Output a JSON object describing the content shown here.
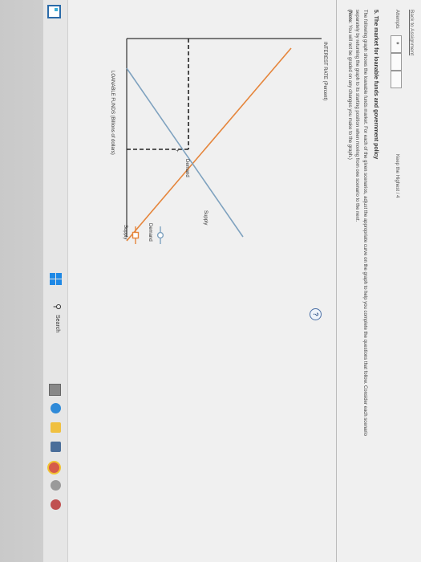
{
  "page": {
    "back_link": "Back to Assignment",
    "attempts_label": "Attempts",
    "attempt_marker": "♦",
    "keep_highest": "Keep the Highest / 4"
  },
  "question": {
    "title": "5. The market for loanable funds and government policy",
    "body": "The following graph shows the loanable funds market. For each of the given scenarios, adjust the appropriate curve on the graph to help you complete the questions that follow. Consider each scenario separately by returning the graph to its starting position when moving from one scenario to the next.",
    "note_prefix": "(Note:",
    "note_body": " You will not be graded on any changes you make to the graph.)"
  },
  "graph": {
    "y_axis_label": "INTEREST RATE (Percent)",
    "x_axis_label": "LOANABLE FUNDS (Billions of dollars)",
    "supply_curve_label": "Supply",
    "demand_curve_label": "Demand",
    "help_symbol": "?",
    "colors": {
      "supply": "#e5853b",
      "demand": "#7fa2bf",
      "axis": "#333333",
      "dashed": "#222222"
    },
    "palette": [
      {
        "label": "Demand",
        "marker": "circle",
        "color": "#7fa2bf"
      },
      {
        "label": "Supply",
        "marker": "square",
        "color": "#e5853b"
      }
    ]
  },
  "taskbar": {
    "search_label": "Search",
    "icons": [
      "windows-icon",
      "search-icon",
      "task-view-icon",
      "edge-icon",
      "file-explorer-icon",
      "store-icon",
      "chrome-icon"
    ]
  }
}
